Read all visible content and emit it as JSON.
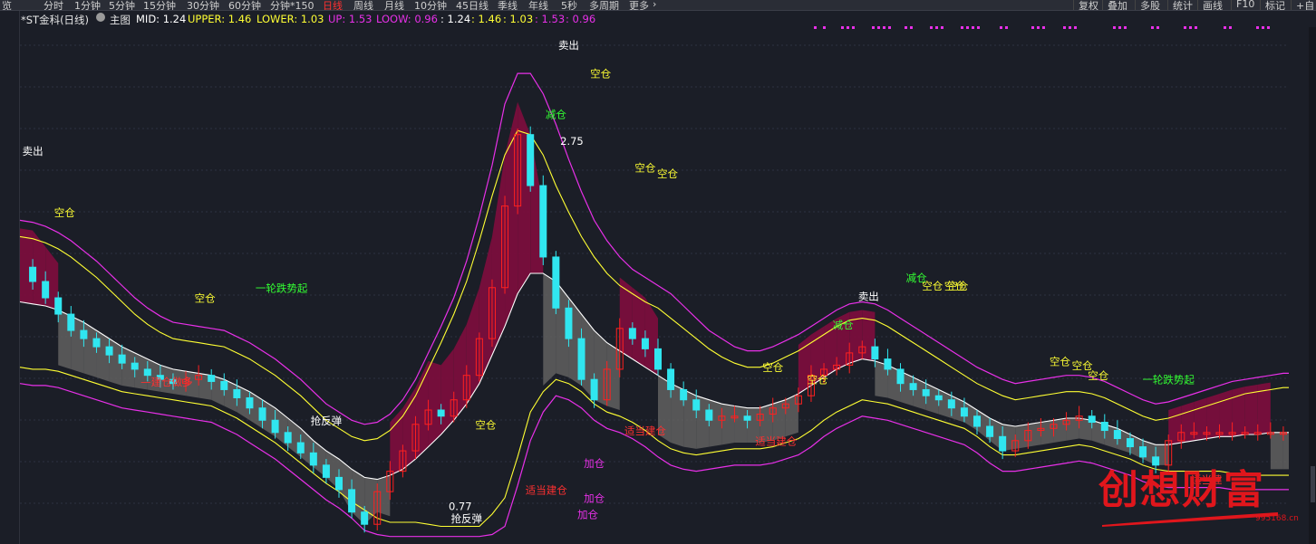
{
  "toolbar": {
    "cut_left": "览",
    "periods": [
      "分时",
      "1分钟",
      "5分钟",
      "15分钟",
      "30分钟",
      "60分钟",
      "分钟*150",
      "日线",
      "周线",
      "月线",
      "10分钟",
      "45日线",
      "季线",
      "年线",
      "5秒",
      "多周期",
      "更多"
    ],
    "active_period": "日线",
    "more_chevron": "›",
    "right_tools": [
      "复权",
      "叠加",
      "多股",
      "统计",
      "画线",
      "F10",
      "标记",
      "+自"
    ]
  },
  "infobar": {
    "title": "*ST金科(日线)",
    "main_label": "主图",
    "mid": "MID: 1.24",
    "upper": "UPPER: 1.46",
    "lower": "LOWER: 1.03",
    "up": "UP: 1.53",
    "loow": "LOOW: 0.96",
    "v1": ": 1.24",
    "v2": ": 1.46",
    "v3": ": 1.03",
    "v4": ": 1.53",
    "v5": ": 0.96"
  },
  "colors": {
    "mid": "#ffffff",
    "upper": "#ffff33",
    "lower": "#ffff33",
    "up": "#e830e8",
    "loow": "#e830e8",
    "up_candle": "#ff2020",
    "down_candle": "#30e6f0",
    "band_bull": "#7a0e3c",
    "band_bear": "#606060",
    "label_white": "#ffffff",
    "label_yellow": "#ffff33",
    "label_green": "#33ff33",
    "label_red": "#ff3030",
    "label_magenta": "#e830e8"
  },
  "watermark": {
    "text": "创想财富",
    "url": "995168.cn"
  },
  "chart_data": {
    "type": "candlestick",
    "title": "*ST金科(日线)",
    "ylim": [
      0.72,
      3.2
    ],
    "x": [
      0,
      4,
      8,
      12,
      16,
      20,
      24,
      28,
      32,
      36,
      40,
      44,
      48,
      52,
      56,
      60,
      64,
      68,
      72,
      76,
      80,
      84,
      88,
      92,
      96,
      100,
      104,
      108,
      112,
      116,
      120,
      124,
      128,
      132,
      136,
      140,
      144,
      148,
      152,
      156,
      160,
      164,
      168,
      172,
      176,
      180,
      184,
      188,
      192,
      196,
      200,
      204,
      208,
      212,
      216,
      220,
      224,
      228,
      232,
      236,
      240,
      244,
      248,
      252,
      256,
      260,
      264,
      268,
      272,
      276,
      280,
      284,
      288,
      292,
      296,
      300,
      304,
      308,
      312,
      316,
      320,
      324,
      328,
      332,
      336,
      340,
      344,
      348,
      352,
      356,
      360,
      364,
      368,
      372,
      376,
      380,
      384,
      388,
      392,
      396,
      400
    ],
    "close": [
      2.05,
      1.98,
      1.9,
      1.82,
      1.74,
      1.7,
      1.66,
      1.62,
      1.58,
      1.55,
      1.52,
      1.5,
      1.48,
      1.5,
      1.52,
      1.49,
      1.45,
      1.41,
      1.36,
      1.3,
      1.24,
      1.19,
      1.14,
      1.08,
      1.02,
      0.96,
      0.85,
      0.79,
      0.95,
      1.05,
      1.15,
      1.28,
      1.35,
      1.32,
      1.4,
      1.52,
      1.7,
      1.95,
      2.35,
      2.7,
      2.45,
      2.1,
      1.85,
      1.7,
      1.5,
      1.4,
      1.55,
      1.75,
      1.7,
      1.65,
      1.55,
      1.45,
      1.4,
      1.35,
      1.3,
      1.32,
      1.32,
      1.3,
      1.33,
      1.36,
      1.38,
      1.42,
      1.52,
      1.55,
      1.57,
      1.63,
      1.66,
      1.6,
      1.55,
      1.48,
      1.45,
      1.42,
      1.4,
      1.36,
      1.32,
      1.27,
      1.22,
      1.15,
      1.2,
      1.25,
      1.26,
      1.28,
      1.3,
      1.32,
      1.29,
      1.25,
      1.21,
      1.17,
      1.12,
      1.08,
      1.2,
      1.24,
      1.24,
      1.24,
      1.24,
      1.24,
      1.24,
      1.24,
      1.24,
      1.24,
      1.24
    ],
    "mid": [
      1.88,
      1.87,
      1.86,
      1.84,
      1.81,
      1.78,
      1.74,
      1.7,
      1.66,
      1.63,
      1.6,
      1.57,
      1.55,
      1.54,
      1.53,
      1.52,
      1.5,
      1.47,
      1.44,
      1.4,
      1.36,
      1.31,
      1.26,
      1.2,
      1.15,
      1.11,
      1.06,
      1.02,
      1.01,
      1.03,
      1.06,
      1.11,
      1.17,
      1.23,
      1.3,
      1.38,
      1.48,
      1.62,
      1.76,
      1.92,
      2.02,
      2.02,
      1.98,
      1.9,
      1.82,
      1.74,
      1.68,
      1.64,
      1.6,
      1.56,
      1.52,
      1.48,
      1.45,
      1.42,
      1.4,
      1.38,
      1.37,
      1.36,
      1.36,
      1.38,
      1.4,
      1.43,
      1.47,
      1.51,
      1.55,
      1.58,
      1.6,
      1.59,
      1.57,
      1.54,
      1.51,
      1.48,
      1.45,
      1.42,
      1.39,
      1.35,
      1.31,
      1.28,
      1.27,
      1.28,
      1.29,
      1.3,
      1.31,
      1.31,
      1.3,
      1.28,
      1.26,
      1.23,
      1.2,
      1.18,
      1.18,
      1.19,
      1.2,
      1.21,
      1.22,
      1.22,
      1.23,
      1.23,
      1.24,
      1.24,
      1.24
    ],
    "upper": [
      2.2,
      2.19,
      2.17,
      2.14,
      2.1,
      2.05,
      2.0,
      1.94,
      1.88,
      1.82,
      1.77,
      1.73,
      1.7,
      1.69,
      1.68,
      1.67,
      1.66,
      1.63,
      1.6,
      1.56,
      1.52,
      1.47,
      1.42,
      1.36,
      1.3,
      1.26,
      1.22,
      1.2,
      1.21,
      1.25,
      1.32,
      1.42,
      1.55,
      1.68,
      1.82,
      1.98,
      2.18,
      2.4,
      2.6,
      2.72,
      2.7,
      2.6,
      2.45,
      2.32,
      2.2,
      2.1,
      2.02,
      1.96,
      1.92,
      1.88,
      1.85,
      1.8,
      1.75,
      1.7,
      1.65,
      1.61,
      1.58,
      1.56,
      1.56,
      1.58,
      1.61,
      1.64,
      1.68,
      1.72,
      1.76,
      1.79,
      1.8,
      1.79,
      1.76,
      1.72,
      1.68,
      1.64,
      1.6,
      1.56,
      1.52,
      1.48,
      1.45,
      1.42,
      1.4,
      1.41,
      1.42,
      1.43,
      1.44,
      1.44,
      1.43,
      1.41,
      1.38,
      1.35,
      1.32,
      1.3,
      1.31,
      1.33,
      1.35,
      1.37,
      1.39,
      1.41,
      1.43,
      1.44,
      1.45,
      1.46,
      1.46
    ],
    "lower": [
      1.56,
      1.55,
      1.55,
      1.54,
      1.52,
      1.5,
      1.48,
      1.46,
      1.44,
      1.43,
      1.42,
      1.41,
      1.4,
      1.39,
      1.38,
      1.37,
      1.34,
      1.31,
      1.27,
      1.23,
      1.19,
      1.14,
      1.09,
      1.04,
      0.99,
      0.95,
      0.9,
      0.86,
      0.82,
      0.8,
      0.8,
      0.8,
      0.79,
      0.78,
      0.78,
      0.78,
      0.78,
      0.84,
      0.92,
      1.12,
      1.34,
      1.44,
      1.5,
      1.48,
      1.44,
      1.38,
      1.34,
      1.32,
      1.29,
      1.25,
      1.2,
      1.16,
      1.14,
      1.13,
      1.14,
      1.15,
      1.16,
      1.16,
      1.16,
      1.17,
      1.19,
      1.21,
      1.25,
      1.3,
      1.34,
      1.37,
      1.4,
      1.39,
      1.38,
      1.36,
      1.34,
      1.32,
      1.3,
      1.28,
      1.26,
      1.22,
      1.17,
      1.13,
      1.13,
      1.14,
      1.15,
      1.16,
      1.17,
      1.18,
      1.17,
      1.15,
      1.13,
      1.11,
      1.08,
      1.06,
      1.05,
      1.05,
      1.05,
      1.05,
      1.05,
      1.04,
      1.04,
      1.03,
      1.03,
      1.03,
      1.03
    ],
    "up": [
      2.28,
      2.27,
      2.25,
      2.22,
      2.18,
      2.13,
      2.08,
      2.02,
      1.96,
      1.9,
      1.85,
      1.81,
      1.78,
      1.77,
      1.76,
      1.75,
      1.74,
      1.71,
      1.68,
      1.64,
      1.6,
      1.55,
      1.5,
      1.44,
      1.38,
      1.34,
      1.3,
      1.28,
      1.29,
      1.33,
      1.4,
      1.5,
      1.63,
      1.76,
      1.9,
      2.08,
      2.3,
      2.55,
      2.85,
      3.0,
      3.0,
      2.9,
      2.75,
      2.58,
      2.42,
      2.28,
      2.18,
      2.1,
      2.04,
      2.0,
      1.96,
      1.92,
      1.86,
      1.8,
      1.74,
      1.7,
      1.66,
      1.64,
      1.64,
      1.66,
      1.69,
      1.72,
      1.76,
      1.8,
      1.84,
      1.87,
      1.88,
      1.87,
      1.84,
      1.8,
      1.76,
      1.72,
      1.68,
      1.64,
      1.6,
      1.56,
      1.53,
      1.5,
      1.48,
      1.49,
      1.5,
      1.51,
      1.52,
      1.52,
      1.51,
      1.49,
      1.46,
      1.43,
      1.4,
      1.38,
      1.39,
      1.41,
      1.43,
      1.45,
      1.47,
      1.49,
      1.5,
      1.51,
      1.52,
      1.53,
      1.53
    ],
    "loow": [
      1.48,
      1.47,
      1.47,
      1.46,
      1.44,
      1.42,
      1.4,
      1.38,
      1.36,
      1.35,
      1.34,
      1.33,
      1.32,
      1.31,
      1.3,
      1.29,
      1.26,
      1.23,
      1.19,
      1.15,
      1.11,
      1.06,
      1.01,
      0.96,
      0.91,
      0.87,
      0.82,
      0.76,
      0.74,
      0.73,
      0.73,
      0.73,
      0.73,
      0.73,
      0.73,
      0.73,
      0.73,
      0.74,
      0.78,
      0.98,
      1.2,
      1.34,
      1.42,
      1.4,
      1.36,
      1.3,
      1.26,
      1.24,
      1.21,
      1.17,
      1.12,
      1.08,
      1.06,
      1.05,
      1.06,
      1.07,
      1.08,
      1.08,
      1.08,
      1.09,
      1.11,
      1.13,
      1.17,
      1.22,
      1.26,
      1.29,
      1.32,
      1.31,
      1.3,
      1.28,
      1.26,
      1.24,
      1.22,
      1.2,
      1.18,
      1.14,
      1.09,
      1.05,
      1.05,
      1.06,
      1.07,
      1.08,
      1.09,
      1.1,
      1.09,
      1.07,
      1.05,
      1.03,
      1.0,
      0.98,
      0.97,
      0.97,
      0.97,
      0.97,
      0.97,
      0.96,
      0.96,
      0.96,
      0.96,
      0.96,
      0.96
    ],
    "annotations": [
      {
        "text": "卖出",
        "x": 4,
        "y": 2.6,
        "color": "white"
      },
      {
        "text": "空仓",
        "x": 14,
        "y": 2.3,
        "color": "yellow"
      },
      {
        "text": "空仓",
        "x": 58,
        "y": 1.88,
        "color": "yellow"
      },
      {
        "text": "一轮跌势起",
        "x": 82,
        "y": 1.93,
        "color": "green"
      },
      {
        "text": "—建仓做多",
        "x": 46,
        "y": 1.47,
        "color": "red"
      },
      {
        "text": "抢反弹",
        "x": 96,
        "y": 1.28,
        "color": "white"
      },
      {
        "text": "卖出",
        "x": 172,
        "y": 3.12,
        "color": "white"
      },
      {
        "text": "空仓",
        "x": 182,
        "y": 2.98,
        "color": "yellow"
      },
      {
        "text": "减仓",
        "x": 168,
        "y": 2.78,
        "color": "green"
      },
      {
        "text": "2.75",
        "x": 173,
        "y": 2.65,
        "color": "white"
      },
      {
        "text": "空仓",
        "x": 196,
        "y": 2.52,
        "color": "yellow"
      },
      {
        "text": "空仓",
        "x": 203,
        "y": 2.49,
        "color": "yellow"
      },
      {
        "text": "空仓",
        "x": 146,
        "y": 1.26,
        "color": "yellow"
      },
      {
        "text": "适当建仓",
        "x": 196,
        "y": 1.23,
        "color": "red"
      },
      {
        "text": "加仓",
        "x": 180,
        "y": 1.07,
        "color": "magenta"
      },
      {
        "text": "适当建仓",
        "x": 165,
        "y": 0.94,
        "color": "red"
      },
      {
        "text": "加仓",
        "x": 180,
        "y": 0.9,
        "color": "magenta"
      },
      {
        "text": "加仓",
        "x": 178,
        "y": 0.82,
        "color": "magenta"
      },
      {
        "text": "0.77",
        "x": 138,
        "y": 0.86,
        "color": "white"
      },
      {
        "text": "抢反弹",
        "x": 140,
        "y": 0.8,
        "color": "white"
      },
      {
        "text": "空仓",
        "x": 236,
        "y": 1.54,
        "color": "yellow"
      },
      {
        "text": "空仓",
        "x": 250,
        "y": 1.48,
        "color": "yellow"
      },
      {
        "text": "适当建仓",
        "x": 237,
        "y": 1.18,
        "color": "red"
      },
      {
        "text": "减仓",
        "x": 258,
        "y": 1.75,
        "color": "green"
      },
      {
        "text": "卖出",
        "x": 266,
        "y": 1.89,
        "color": "white"
      },
      {
        "text": "减仓",
        "x": 281,
        "y": 1.98,
        "color": "green"
      },
      {
        "text": "空仓",
        "x": 286,
        "y": 1.94,
        "color": "yellow"
      },
      {
        "text": "空仓",
        "x": 294,
        "y": 1.94,
        "color": "yellow"
      },
      {
        "text": "空仓",
        "x": 293,
        "y": 1.94,
        "color": "yellow"
      },
      {
        "text": "空仓",
        "x": 326,
        "y": 1.57,
        "color": "yellow"
      },
      {
        "text": "空仓",
        "x": 333,
        "y": 1.55,
        "color": "yellow"
      },
      {
        "text": "空仓",
        "x": 338,
        "y": 1.5,
        "color": "yellow"
      },
      {
        "text": "一轮跌势起",
        "x": 360,
        "y": 1.48,
        "color": "green"
      },
      {
        "text": "适当建",
        "x": 372,
        "y": 0.99,
        "color": "red"
      }
    ]
  }
}
